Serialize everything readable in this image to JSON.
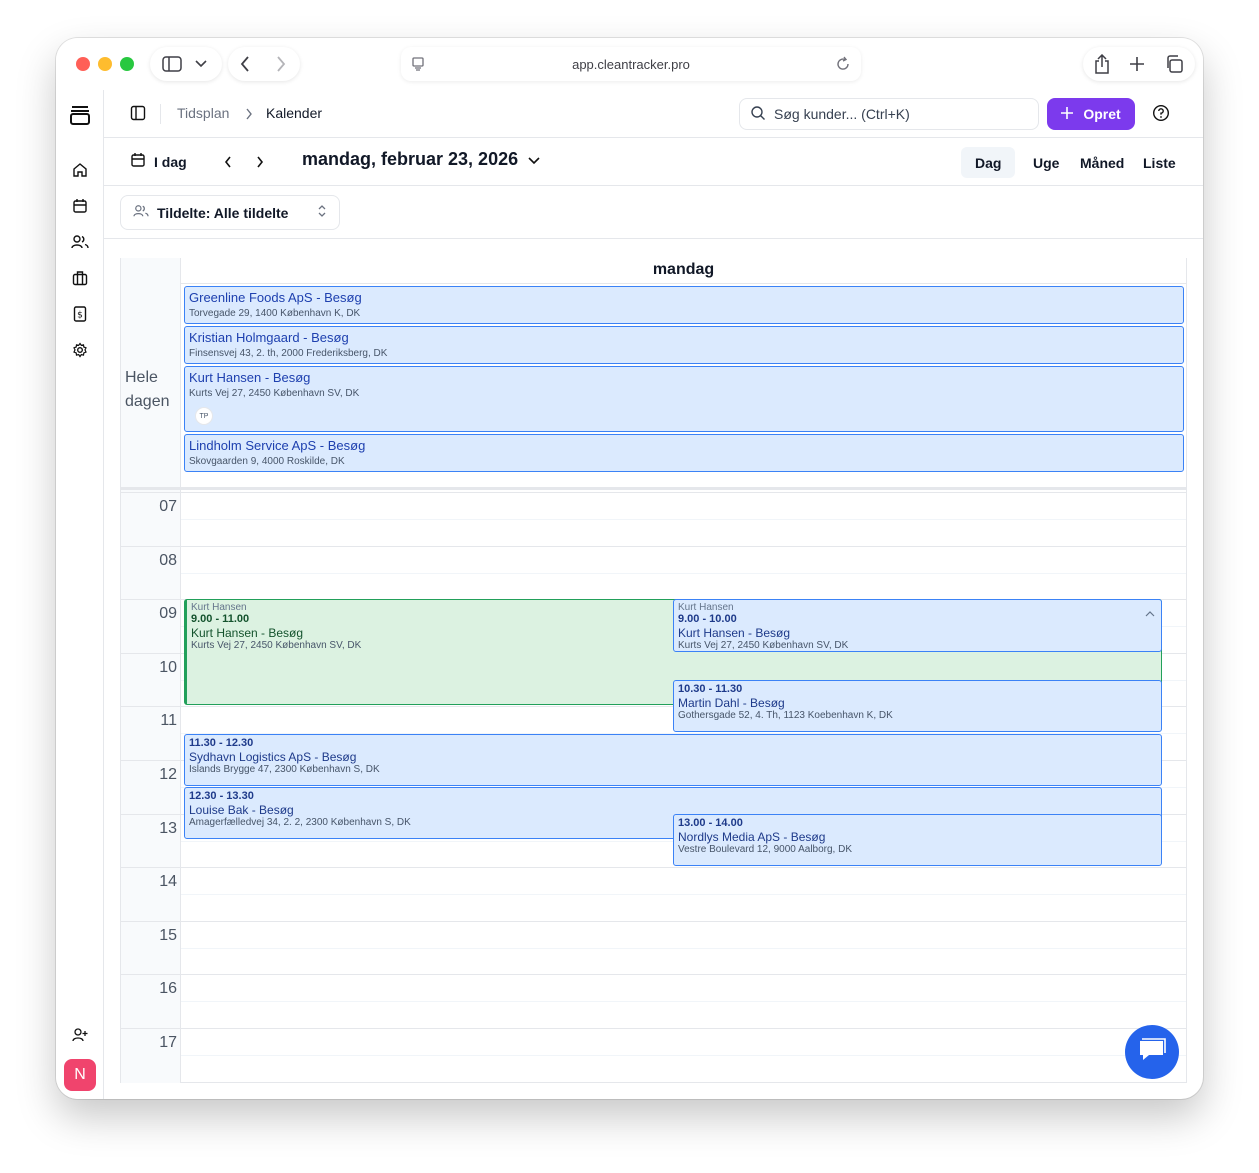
{
  "browser": {
    "url": "app.cleantracker.pro"
  },
  "header": {
    "breadcrumb": [
      "Tidsplan",
      "Kalender"
    ],
    "search_placeholder": "Søg kunder... (Ctrl+K)",
    "create_label": "Opret"
  },
  "toolbar": {
    "today_label": "I dag",
    "date_label": "mandag, februar 23, 2026",
    "views": [
      "Dag",
      "Uge",
      "Måned",
      "Liste"
    ],
    "active_view": "Dag"
  },
  "filter": {
    "label": "Tildelte: Alle tildelte"
  },
  "calendar": {
    "day_header": "mandag",
    "allday_label_1": "Hele",
    "allday_label_2": "dagen",
    "allday_events": [
      {
        "title": "Greenline Foods ApS - Besøg",
        "address": "Torvegade 29, 1400 København K, DK"
      },
      {
        "title": "Kristian Holmgaard - Besøg",
        "address": "Finsensvej 43, 2. th, 2000 Frederiksberg, DK"
      },
      {
        "title": "Kurt Hansen - Besøg",
        "address": "Kurts Vej 27, 2450 København SV, DK",
        "badge": "TP"
      },
      {
        "title": "Lindholm Service ApS - Besøg",
        "address": "Skovgaarden 9, 4000 Roskilde, DK"
      }
    ],
    "hours": [
      "07",
      "08",
      "09",
      "10",
      "11",
      "12",
      "13",
      "14",
      "15",
      "16",
      "17"
    ],
    "events": [
      {
        "assignee": "Kurt Hansen",
        "time": "9.00 - 11.00",
        "title": "Kurt Hansen - Besøg",
        "address": "Kurts Vej 27, 2450 København SV, DK",
        "color": "green"
      },
      {
        "assignee": "Kurt Hansen",
        "time": "9.00 - 10.00",
        "title": "Kurt Hansen - Besøg",
        "address": "Kurts Vej 27, 2450 København SV, DK",
        "color": "blue"
      },
      {
        "assignee": "",
        "time": "10.30 - 11.30",
        "title": "Martin Dahl - Besøg",
        "address": "Gothersgade 52, 4. Th, 1123 Koebenhavn K, DK",
        "color": "blue"
      },
      {
        "assignee": "",
        "time": "11.30 - 12.30",
        "title": "Sydhavn Logistics ApS - Besøg",
        "address": "Islands Brygge 47, 2300 København S, DK",
        "color": "blue"
      },
      {
        "assignee": "",
        "time": "12.30 - 13.30",
        "title": "Louise Bak - Besøg",
        "address": "Amagerfælledvej 34, 2. 2, 2300 København S, DK",
        "color": "blue"
      },
      {
        "assignee": "",
        "time": "13.00 - 14.00",
        "title": "Nordlys Media ApS - Besøg",
        "address": "Vestre Boulevard 12, 9000 Aalborg, DK",
        "color": "blue"
      }
    ]
  },
  "sidebar": {
    "icons": [
      "logo-icon",
      "home-icon",
      "calendar-icon",
      "users-icon",
      "briefcase-icon",
      "invoice-icon",
      "settings-icon",
      "add-user-icon"
    ],
    "avatar": "N"
  },
  "colors": {
    "accent": "#7c3aed",
    "event_blue": "#dbeafe",
    "event_green": "#dcf2e1",
    "avatar": "#f0446d"
  }
}
